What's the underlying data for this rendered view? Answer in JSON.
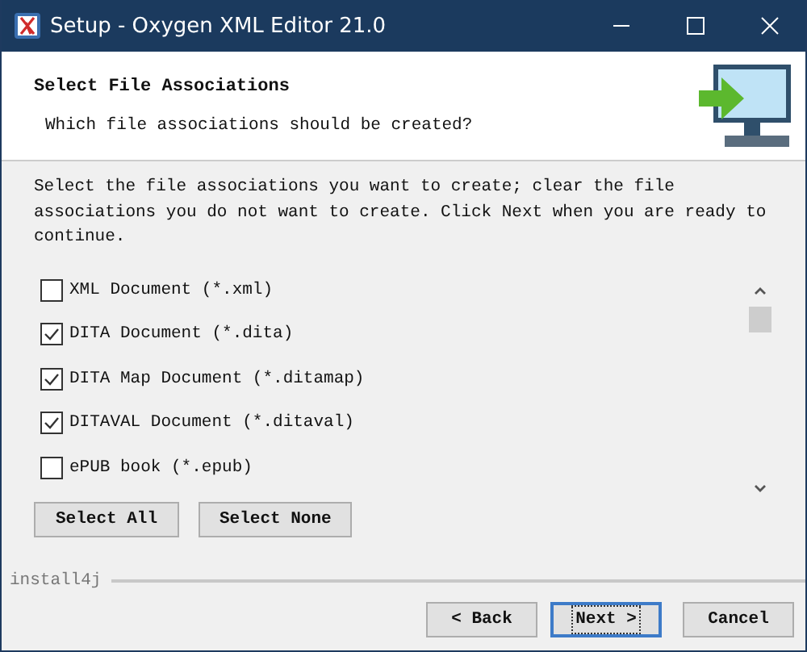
{
  "window": {
    "title": "Setup - Oxygen XML Editor 21.0"
  },
  "header": {
    "title": "Select File Associations",
    "subtitle": "Which file associations should be created?"
  },
  "instructions": "Select the file associations you want to create; clear the file associations you do not want to create. Click Next when you are ready to continue.",
  "associations": [
    {
      "label": "XML Document (*.xml)",
      "checked": false
    },
    {
      "label": "DITA Document (*.dita)",
      "checked": true
    },
    {
      "label": "DITA Map Document (*.ditamap)",
      "checked": true
    },
    {
      "label": "DITAVAL Document (*.ditaval)",
      "checked": true
    },
    {
      "label": "ePUB book (*.epub)",
      "checked": false
    }
  ],
  "selection_buttons": [
    "Select All",
    "Select None"
  ],
  "brand": "install4j",
  "nav_buttons": [
    {
      "label": "< Back",
      "focused": false
    },
    {
      "label": "Next >",
      "focused": true
    },
    {
      "label": "Cancel",
      "focused": false
    }
  ]
}
